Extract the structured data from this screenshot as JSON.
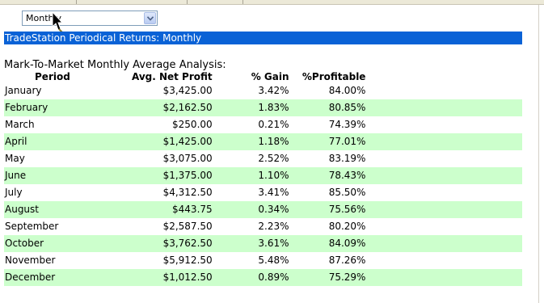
{
  "period_select": {
    "value": "Monthly"
  },
  "banner": {
    "title": "TradeStation Periodical Returns: Monthly"
  },
  "analysis": {
    "title": "Mark-To-Market Monthly Average Analysis:",
    "columns": [
      "Period",
      "Avg. Net Profit",
      "% Gain",
      "%Profitable"
    ],
    "rows": [
      {
        "period": "January",
        "profit": "$3,425.00",
        "gain": "3.42%",
        "profitable": "84.00%"
      },
      {
        "period": "February",
        "profit": "$2,162.50",
        "gain": "1.83%",
        "profitable": "80.85%"
      },
      {
        "period": "March",
        "profit": "$250.00",
        "gain": "0.21%",
        "profitable": "74.39%"
      },
      {
        "period": "April",
        "profit": "$1,425.00",
        "gain": "1.18%",
        "profitable": "77.01%"
      },
      {
        "period": "May",
        "profit": "$3,075.00",
        "gain": "2.52%",
        "profitable": "83.19%"
      },
      {
        "period": "June",
        "profit": "$1,375.00",
        "gain": "1.10%",
        "profitable": "78.43%"
      },
      {
        "period": "July",
        "profit": "$4,312.50",
        "gain": "3.41%",
        "profitable": "85.50%"
      },
      {
        "period": "August",
        "profit": "$443.75",
        "gain": "0.34%",
        "profitable": "75.56%"
      },
      {
        "period": "September",
        "profit": "$2,587.50",
        "gain": "2.23%",
        "profitable": "80.20%"
      },
      {
        "period": "October",
        "profit": "$3,762.50",
        "gain": "3.61%",
        "profitable": "84.09%"
      },
      {
        "period": "November",
        "profit": "$5,912.50",
        "gain": "5.48%",
        "profitable": "87.26%"
      },
      {
        "period": "December",
        "profit": "$1,012.50",
        "gain": "0.89%",
        "profitable": "75.29%"
      }
    ]
  },
  "colors": {
    "banner": "#0a62d6",
    "alt_row": "#ccffcc"
  },
  "icons": {
    "dropdown": "chevron-down-icon",
    "cursor": "mouse-pointer-icon"
  }
}
